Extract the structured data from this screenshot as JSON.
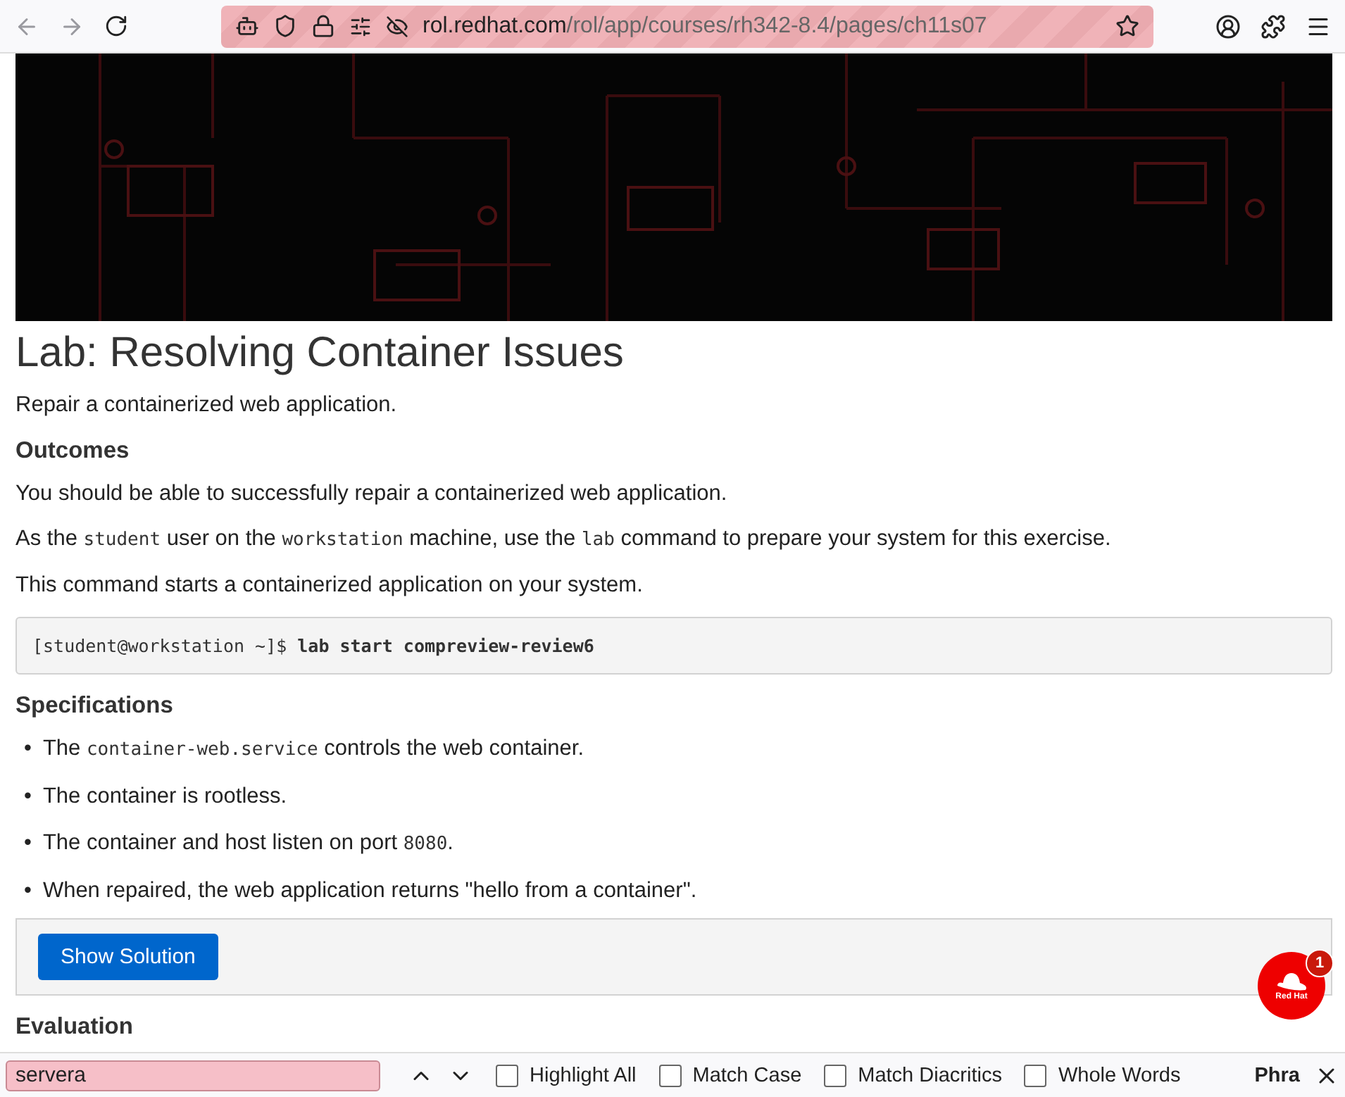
{
  "browser": {
    "url_host": "rol.redhat.com",
    "url_path": "/rol/app/courses/rh342-8.4/pages/ch11s07"
  },
  "page": {
    "title": "Lab: Resolving Container Issues",
    "subtitle": "Repair a containerized web application.",
    "sections": [
      {
        "kind": "heading",
        "text": "Outcomes"
      },
      {
        "kind": "para",
        "parts": [
          {
            "kind": "text",
            "text": "You should be able to successfully repair a containerized web application."
          }
        ]
      },
      {
        "kind": "para",
        "parts": [
          {
            "kind": "text",
            "text": "As the "
          },
          {
            "kind": "code",
            "text": "student"
          },
          {
            "kind": "text",
            "text": " user on the "
          },
          {
            "kind": "code",
            "text": "workstation"
          },
          {
            "kind": "text",
            "text": " machine, use the "
          },
          {
            "kind": "code",
            "text": "lab"
          },
          {
            "kind": "text",
            "text": " command to prepare your system for this exercise."
          }
        ]
      },
      {
        "kind": "para",
        "parts": [
          {
            "kind": "text",
            "text": "This command starts a containerized application on your system."
          }
        ]
      },
      {
        "kind": "command",
        "prompt": "[student@workstation ~]$ ",
        "command": "lab start compreview-review6"
      },
      {
        "kind": "heading",
        "text": "Specifications"
      },
      {
        "kind": "bullets",
        "marker": "•",
        "items": [
          [
            {
              "kind": "text",
              "text": "The "
            },
            {
              "kind": "code",
              "text": "container-web.service"
            },
            {
              "kind": "text",
              "text": " controls the web container."
            }
          ],
          [
            {
              "kind": "text",
              "text": "The container is rootless."
            }
          ],
          [
            {
              "kind": "text",
              "text": "The container and host listen on port "
            },
            {
              "kind": "code",
              "text": "8080"
            },
            {
              "kind": "text",
              "text": "."
            }
          ],
          [
            {
              "kind": "text",
              "text": "When repaired, the web application returns \"hello from a container\"."
            }
          ]
        ]
      },
      {
        "kind": "solution",
        "button": "Show Solution"
      },
      {
        "kind": "heading",
        "text": "Evaluation"
      }
    ]
  },
  "chat": {
    "logo": "Red Hat",
    "badge": "1"
  },
  "find_bar": {
    "query": "servera",
    "options": [
      {
        "label": "Highlight All",
        "checked": false
      },
      {
        "label": "Match Case",
        "checked": false
      },
      {
        "label": "Match Diacritics",
        "checked": false
      },
      {
        "label": "Whole Words",
        "checked": false
      }
    ],
    "more": "Phra"
  }
}
